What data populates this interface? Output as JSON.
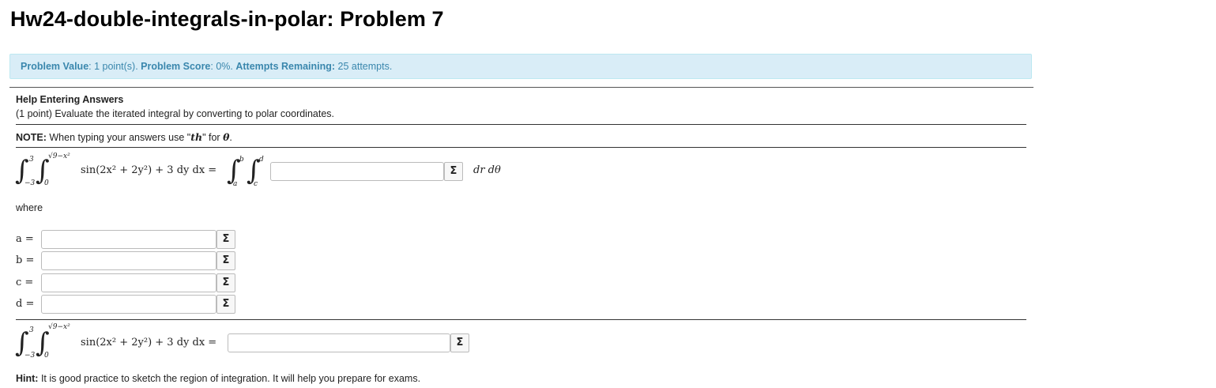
{
  "header": {
    "title": "Hw24-double-integrals-in-polar: Problem 7"
  },
  "info_bar": {
    "value_label": "Problem Value",
    "value_text": ": 1 point(s). ",
    "score_label": "Problem Score",
    "score_text": ": 0%. ",
    "attempts_label": "Attempts Remaining:",
    "attempts_text": " 25 attempts."
  },
  "help_link": "Help Entering Answers",
  "statement": "(1 point) Evaluate the iterated integral by converting to polar coordinates.",
  "note": {
    "label": "NOTE:",
    "text_before": " When typing your answers use \"",
    "code": "th",
    "text_after": "\" for ",
    "symbol": "θ",
    "end": "."
  },
  "equation1": {
    "outer_upper": "3",
    "outer_lower": "−3",
    "inner_upper": "√9−x²",
    "inner_lower": "0",
    "integrand": "sin(2x² + 2y²) + 3 dy dx =",
    "polar_outer_upper": "b",
    "polar_outer_lower": "a",
    "polar_inner_upper": "d",
    "polar_inner_lower": "c",
    "answer_value": "",
    "suffix": "dr dθ"
  },
  "where_text": "where",
  "bounds": [
    {
      "label": "a =",
      "value": ""
    },
    {
      "label": "b =",
      "value": ""
    },
    {
      "label": "c =",
      "value": ""
    },
    {
      "label": "d =",
      "value": ""
    }
  ],
  "equation2": {
    "outer_upper": "3",
    "outer_lower": "−3",
    "inner_upper": "√9−x²",
    "inner_lower": "0",
    "integrand": "sin(2x² + 2y²) + 3 dy dx =",
    "answer_value": ""
  },
  "equation_editor_icon": "Σ",
  "hint": {
    "label": "Hint:",
    "text": " It is good practice to sketch the region of integration. It will help you prepare for exams."
  }
}
